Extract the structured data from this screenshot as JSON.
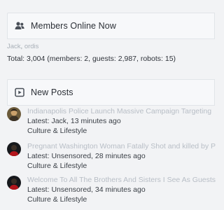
{
  "members_online": {
    "title": "Members Online Now",
    "icon": "users-icon",
    "users": [
      "Jack",
      "ordis"
    ],
    "separator": ", ",
    "total": "Total: 3,004 (members: 2, guests: 2,987, robots: 15)"
  },
  "new_posts": {
    "title": "New Posts",
    "icon": "play-square-icon",
    "posts": [
      {
        "title": "Indianapolis Police Launch Massive Campaign Targeting",
        "latest": "Latest: Jack, 13 minutes ago",
        "forum": "Culture & Lifestyle",
        "avatar": "photo-avatar"
      },
      {
        "title": "Pregnant Washington Woman Fatally Shot and killed by P",
        "latest": "Latest: Unsensored, 28 minutes ago",
        "forum": "Culture & Lifestyle",
        "avatar": "dark-avatar"
      },
      {
        "title": "Welcome To All The Brothers And Sisters I See As Guests",
        "latest": "Latest: Unsensored, 34 minutes ago",
        "forum": "Culture & Lifestyle",
        "avatar": "dark-avatar"
      }
    ]
  },
  "colors": {
    "header_bg": "#f7f8fa",
    "border": "#e1e4e8",
    "muted_link": "#b8bec6",
    "text": "#3a3f46"
  }
}
